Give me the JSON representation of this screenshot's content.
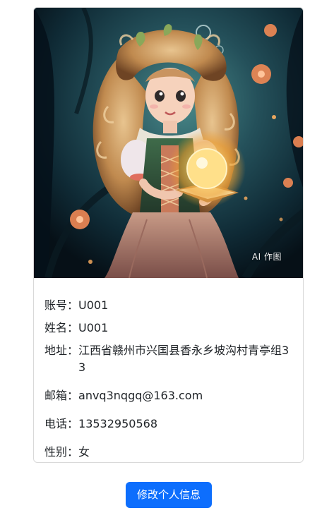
{
  "profile": {
    "image": {
      "badge": "AI 作图",
      "icon": "profile-illustration"
    },
    "fields": {
      "account": {
        "label": "账号：",
        "value": "U001"
      },
      "name": {
        "label": "姓名：",
        "value": "U001"
      },
      "address": {
        "label": "地址：",
        "value": "江西省赣州市兴国县香永乡坡沟村青亭组33"
      },
      "email": {
        "label": "邮箱：",
        "value": "anvq3nqgq@163.com"
      },
      "phone": {
        "label": "电话：",
        "value": "13532950568"
      },
      "gender": {
        "label": "性别：",
        "value": "女"
      }
    }
  },
  "actions": {
    "edit_label": "修改个人信息"
  },
  "colors": {
    "primary": "#0d6efd",
    "card_border": "#d9d9d9"
  }
}
